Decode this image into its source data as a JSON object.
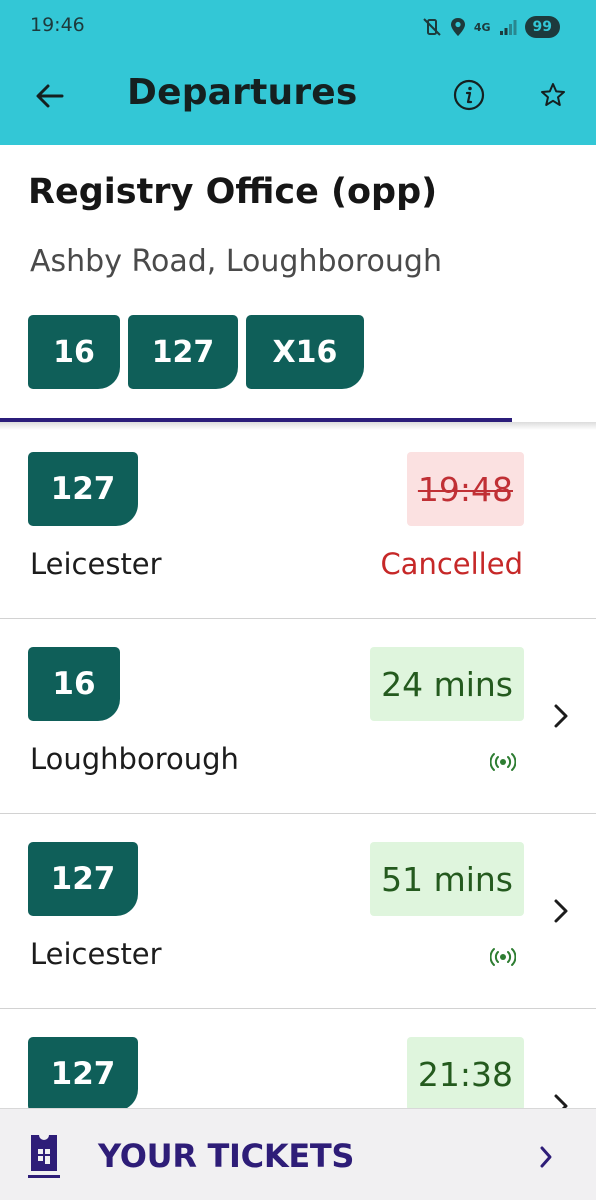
{
  "status_bar": {
    "time": "19:46",
    "network": "4G",
    "battery": "99",
    "icons": [
      "mute-vibrate-icon",
      "location-icon",
      "network-4g-icon",
      "signal-icon",
      "battery-icon"
    ]
  },
  "app_bar": {
    "title": "Departures",
    "back_icon": "arrow-left-icon",
    "info_icon": "info-icon",
    "favourite_icon": "star-outline-icon",
    "background": "#33c7d6"
  },
  "stop": {
    "name": "Registry Office (opp)",
    "location": "Ashby Road, Loughborough",
    "routes": [
      "16",
      "127",
      "X16"
    ]
  },
  "departures": [
    {
      "route": "127",
      "destination": "Leicester",
      "time": "19:48",
      "status": "Cancelled",
      "cancelled": true,
      "realtime": false,
      "has_chevron": false
    },
    {
      "route": "16",
      "destination": "Loughborough",
      "time": "24 mins",
      "status": "",
      "cancelled": false,
      "realtime": true,
      "has_chevron": true
    },
    {
      "route": "127",
      "destination": "Leicester",
      "time": "51 mins",
      "status": "",
      "cancelled": false,
      "realtime": true,
      "has_chevron": true
    },
    {
      "route": "127",
      "destination": "",
      "time": "21:38",
      "status": "",
      "cancelled": false,
      "realtime": false,
      "has_chevron": true
    }
  ],
  "tickets_bar": {
    "label": "YOUR TICKETS",
    "icon": "ticket-icon",
    "chevron_icon": "chevron-right-icon"
  },
  "colors": {
    "brand_teal": "#33c7d6",
    "route_green": "#0f5f59",
    "live_bg": "#dff5dd",
    "live_text": "#245a1e",
    "cancel_bg": "#fbe1e1",
    "cancel_text": "#c62828",
    "accent_purple": "#2e1d78"
  }
}
